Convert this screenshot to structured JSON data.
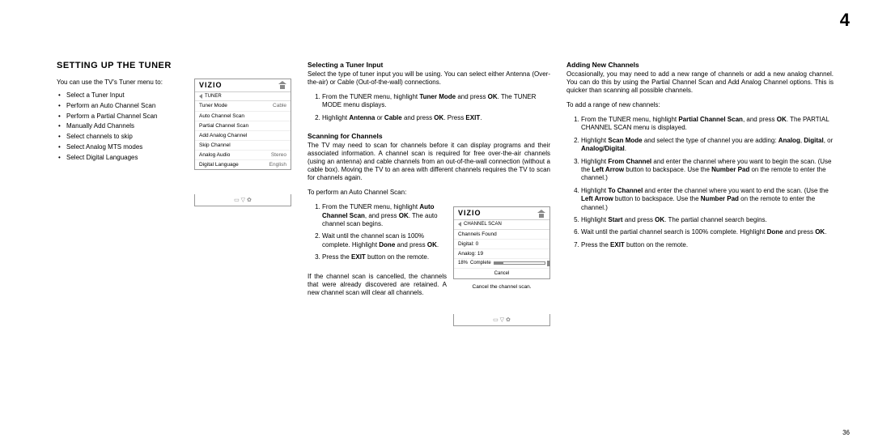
{
  "page_number_top": "4",
  "page_number_bottom": "36",
  "title": "SETTING UP THE TUNER",
  "intro": "You can use the TV's Tuner menu to:",
  "bullets": [
    "Select a Tuner Input",
    "Perform an Auto Channel Scan",
    "Perform a Partial Channel Scan",
    "Manually Add Channels",
    "Select channels to skip",
    "Select Analog MTS modes",
    "Select Digital Languages"
  ],
  "menu1": {
    "brand": "VIZIO",
    "sub": "TUNER",
    "rows": [
      {
        "l": "Tuner Mode",
        "v": "Cable"
      },
      {
        "l": "Auto Channel Scan",
        "v": ""
      },
      {
        "l": "Partial Channel Scan",
        "v": ""
      },
      {
        "l": "Add Analog Channel",
        "v": ""
      },
      {
        "l": "Skip Channel",
        "v": ""
      },
      {
        "l": "Analog Audio",
        "v": "Stereo"
      },
      {
        "l": "Digital Language",
        "v": "English"
      }
    ]
  },
  "sec_select_title": "Selecting a Tuner Input",
  "sec_select_para": "Select the type of tuner input you will be using. You can select either Antenna (Over-the-air) or Cable (Out-of-the-wall) connections.",
  "sec_select_list": [
    "From the TUNER menu, highlight <b>Tuner Mode</b> and press <b>OK</b>. The TUNER MODE menu displays.",
    "Highlight <b>Antenna</b> or <b>Cable</b> and press <b>OK</b>. Press <b>EXIT</b>."
  ],
  "sec_scan_title": "Scanning for Channels",
  "sec_scan_para": "The TV may need to scan for channels before it can display programs and their associated information. A channel scan is required for free over-the-air channels (using an antenna) and cable channels from an out-of-the-wall connection (without a cable box). Moving the TV to an area with different channels requires the TV to scan for channels again.",
  "sec_scan_perform": "To perform an Auto Channel Scan:",
  "sec_scan_list": [
    "From the TUNER menu, highlight <b>Auto Channel Scan</b>, and press <b>OK</b>. The auto channel scan begins.",
    "Wait until the channel scan is 100% complete. Highlight <b>Done</b> and press <b>OK</b>.",
    "Press the <b>EXIT</b> button on the remote."
  ],
  "sec_scan_cancel_para": "If the channel scan is cancelled, the channels that were already discovered are retained. A new channel scan will clear all channels.",
  "menu2": {
    "brand": "VIZIO",
    "sub": "CHANNEL SCAN",
    "rows": [
      {
        "l": "Channels Found",
        "v": ""
      },
      {
        "l": "Digital: 0",
        "v": ""
      },
      {
        "l": "Analog: 19",
        "v": ""
      }
    ],
    "progress_pct": "18%",
    "progress_label": "Complete",
    "cancel": "Cancel",
    "caption": "Cancel the channel scan."
  },
  "sec_add_title": "Adding New Channels",
  "sec_add_para": "Occasionally, you may need to add a new range of channels or add a new analog channel. You can do this by using the Partial Channel Scan and Add Analog Channel options. This is quicker than scanning all possible channels.",
  "sec_add_intro": "To add a range of new channels:",
  "sec_add_list": [
    "From the TUNER menu, highlight <b>Partial Channel Scan</b>, and press <b>OK</b>. The PARTIAL CHANNEL SCAN menu is displayed.",
    "Highlight <b>Scan Mode</b> and select the type of channel you are adding: <b>Analog</b>, <b>Digital</b>, or <b>Analog/Digital</b>.",
    "Highlight <b>From Channel</b> and enter the channel where you want to begin the scan. (Use the <b>Left Arrow</b> button to backspace. Use the <b>Number Pad</b> on the remote to enter the channel.)",
    "Highlight <b>To Channel</b> and enter the channel where you want to end the scan. (Use the <b>Left Arrow</b> button to backspace. Use the <b>Number Pad</b> on the remote to enter the channel.)",
    "Highlight <b>Start</b> and press <b>OK</b>. The partial channel search begins.",
    "Wait until the partial channel search is 100% complete. Highlight <b>Done</b> and press <b>OK</b>.",
    "Press the <b>EXIT</b> button on the remote."
  ],
  "icons_glyph": "▭  ▽  ✿"
}
